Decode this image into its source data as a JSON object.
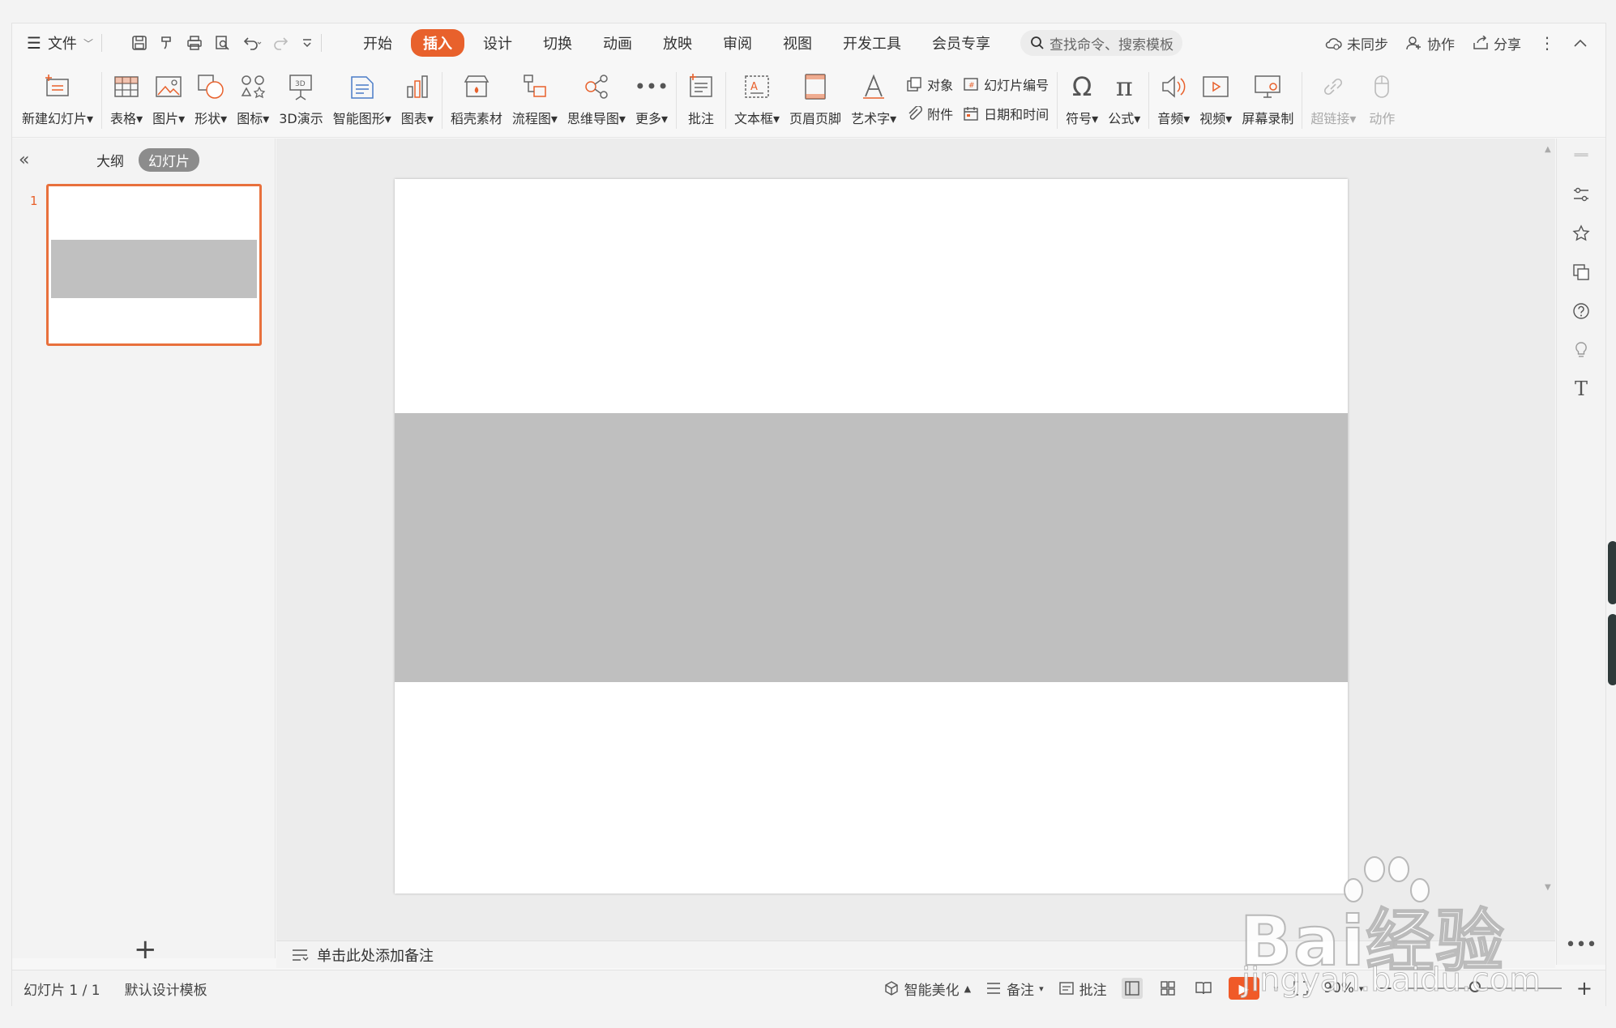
{
  "topbar": {
    "file_label": "文件",
    "tabs": [
      "开始",
      "插入",
      "设计",
      "切换",
      "动画",
      "放映",
      "审阅",
      "视图",
      "开发工具",
      "会员专享"
    ],
    "active_tab": "插入",
    "search_placeholder": "查找命令、搜索模板",
    "sync_label": "未同步",
    "collab_label": "协作",
    "share_label": "分享"
  },
  "ribbon": {
    "new_slide": "新建幻灯片",
    "table": "表格",
    "picture": "图片",
    "shape": "形状",
    "icon": "图标",
    "demo3d": "3D演示",
    "smart_graphic": "智能图形",
    "chart": "图表",
    "material": "稻壳素材",
    "flowchart": "流程图",
    "mindmap": "思维导图",
    "more": "更多",
    "comment": "批注",
    "textbox": "文本框",
    "header_footer": "页眉页脚",
    "wordart": "艺术字",
    "object": "对象",
    "attachment": "附件",
    "slide_number": "幻灯片编号",
    "datetime": "日期和时间",
    "symbol": "符号",
    "formula": "公式",
    "audio": "音频",
    "video": "视频",
    "screen_record": "屏幕录制",
    "hyperlink": "超链接",
    "action": "动作"
  },
  "leftpanel": {
    "outline_tab": "大纲",
    "slides_tab": "幻灯片",
    "slide_number": "1"
  },
  "notes_placeholder": "单击此处添加备注",
  "statusbar": {
    "slide_info": "幻灯片 1 / 1",
    "template": "默认设计模板",
    "beautify": "智能美化",
    "notes": "备注",
    "comment": "批注",
    "zoom": "90%"
  },
  "watermark": {
    "main": "Bai经验",
    "url": "jingyan.baidu.com"
  },
  "colors": {
    "accent": "#e8612c",
    "slide_band": "#bfbfbf",
    "thumb_border": "#e8703c"
  }
}
